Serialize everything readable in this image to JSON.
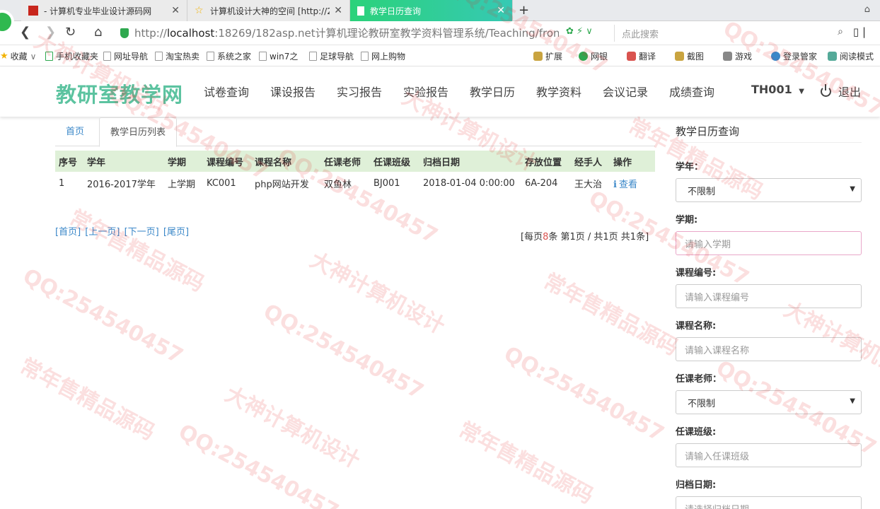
{
  "browser": {
    "tabs": [
      {
        "title": "- 计算机专业毕业设计源码网",
        "icon": "flag-icon"
      },
      {
        "title": "计算机设计大神的空间 [http://2",
        "icon": "star-icon"
      },
      {
        "title": "教学日历查询",
        "icon": "page-icon"
      }
    ],
    "new_tab": "+",
    "url_prefix": "http://",
    "url_host": "localhost",
    "url_rest": ":18269/182asp.net计算机理论教研室教学资料管理系统/Teaching/fron",
    "search_placeholder": "点此搜索",
    "bookmarks": [
      "收藏",
      "手机收藏夹",
      "网址导航",
      "淘宝热卖",
      "系统之家",
      "win7之",
      "足球导航",
      "网上购物"
    ],
    "tools": [
      "扩展",
      "网银",
      "翻译",
      "截图",
      "游戏",
      "登录管家",
      "阅读模式"
    ]
  },
  "site": {
    "brand": "教研室教学网",
    "nav": [
      "试卷查询",
      "课设报告",
      "实习报告",
      "实验报告",
      "教学日历",
      "教学资料",
      "会议记录",
      "成绩查询"
    ],
    "user": "TH001",
    "logout": "退出"
  },
  "content": {
    "tabs": [
      "首页",
      "教学日历列表"
    ],
    "table": {
      "headers": [
        "序号",
        "学年",
        "学期",
        "课程编号",
        "课程名称",
        "任课老师",
        "任课班级",
        "归档日期",
        "存放位置",
        "经手人",
        "操作"
      ],
      "rows": [
        [
          "1",
          "2016-2017学年",
          "上学期",
          "KC001",
          "php网站开发",
          "双鱼林",
          "BJ001",
          "2018-01-04 0:00:00",
          "6A-204",
          "王大治",
          "查看"
        ]
      ]
    },
    "pager": {
      "first": "[首页]",
      "prev": "[上一页]",
      "next": "[下一页]",
      "last": "[尾页]",
      "info_prefix": "[每页",
      "per_page": "8",
      "info_suffix": "条 第1页 / 共1页 共1条]"
    }
  },
  "panel": {
    "title": "教学日历查询",
    "fields": [
      {
        "label": "学年：",
        "type": "select",
        "value": "不限制"
      },
      {
        "label": "学期:",
        "type": "input",
        "placeholder": "请输入学期"
      },
      {
        "label": "课程编号:",
        "type": "input",
        "placeholder": "请输入课程编号"
      },
      {
        "label": "课程名称:",
        "type": "input",
        "placeholder": "请输入课程名称"
      },
      {
        "label": "任课老师：",
        "type": "select",
        "value": "不限制"
      },
      {
        "label": "任课班级:",
        "type": "input",
        "placeholder": "请输入任课班级"
      },
      {
        "label": "归档日期:",
        "type": "input",
        "placeholder": "请选择归档日期"
      }
    ]
  },
  "watermark": {
    "lines": [
      "QQ:254540457",
      "常年售精品源码",
      "大神计算机设计"
    ],
    "color": "#e12828"
  },
  "colors": {
    "brand": "#5cc3a0",
    "table_header": "#dff0d8",
    "link": "#3a87c8",
    "active_tab": "#2bd27a"
  }
}
